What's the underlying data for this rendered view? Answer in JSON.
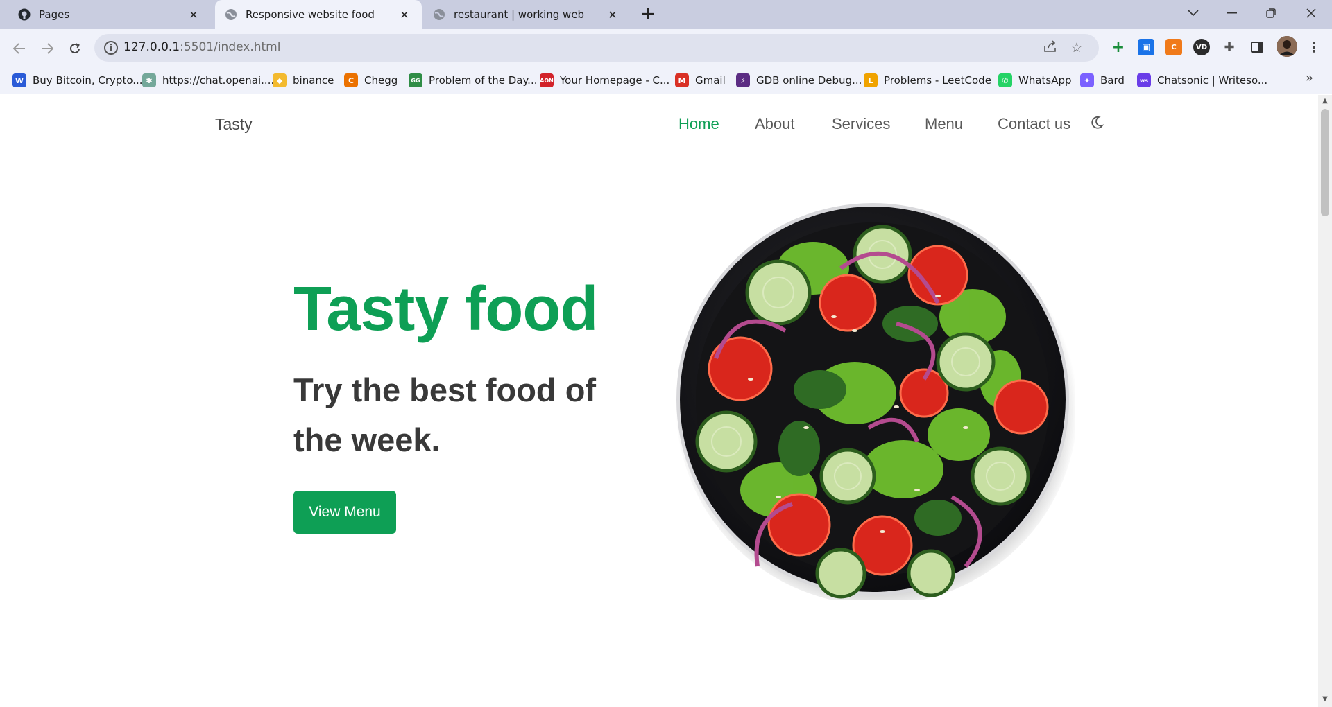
{
  "browser": {
    "tabs": [
      {
        "title": "Pages",
        "icon": "github-icon",
        "active": false
      },
      {
        "title": "Responsive website food",
        "icon": "globe-icon",
        "active": true
      },
      {
        "title": "restaurant | working web",
        "icon": "globe-icon",
        "active": false
      }
    ],
    "url": {
      "host": "127.0.0.1",
      "rest": ":5501/index.html"
    },
    "bookmarks": [
      {
        "label": "Buy Bitcoin, Crypto...",
        "icon_color": "#2a5bd7",
        "glyph": "W"
      },
      {
        "label": "https://chat.openai....",
        "icon_color": "#74a89a",
        "glyph": "✱"
      },
      {
        "label": "binance",
        "icon_color": "#f3ba2f",
        "glyph": "◆"
      },
      {
        "label": "Chegg",
        "icon_color": "#eb7100",
        "glyph": "C"
      },
      {
        "label": "Problem of the Day...",
        "icon_color": "#2f8d46",
        "glyph": "GG"
      },
      {
        "label": "Your Homepage - C...",
        "icon_color": "#d2232a",
        "glyph": "AON"
      },
      {
        "label": "Gmail",
        "icon_color": "#d93025",
        "glyph": "M"
      },
      {
        "label": "GDB online Debug...",
        "icon_color": "#5b2c83",
        "glyph": "⚡"
      },
      {
        "label": "Problems - LeetCode",
        "icon_color": "#f0a300",
        "glyph": "L"
      },
      {
        "label": "WhatsApp",
        "icon_color": "#25d366",
        "glyph": "✆"
      },
      {
        "label": "Bard",
        "icon_color": "#7b61ff",
        "glyph": "✦"
      },
      {
        "label": "Chatsonic | Writeso...",
        "icon_color": "#6a3de8",
        "glyph": "ws"
      }
    ]
  },
  "nav": {
    "logo": "Tasty",
    "items": [
      {
        "label": "Home",
        "active": true
      },
      {
        "label": "About",
        "active": false
      },
      {
        "label": "Services",
        "active": false
      },
      {
        "label": "Menu",
        "active": false
      },
      {
        "label": "Contact us",
        "active": false
      }
    ]
  },
  "hero": {
    "title": "Tasty food",
    "subtitle": "Try the best food of the week.",
    "button": "View Menu"
  },
  "colors": {
    "brand": "#0e9f55",
    "text_dark": "#393939"
  }
}
